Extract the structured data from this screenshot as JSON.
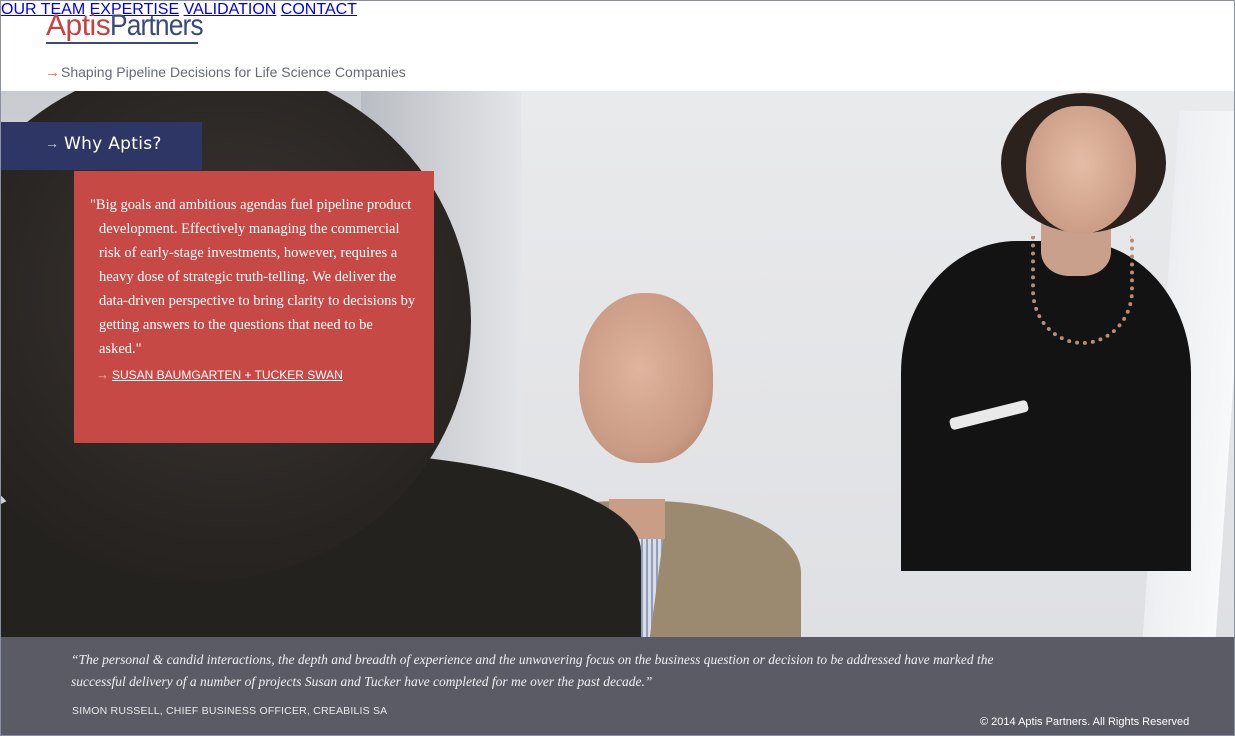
{
  "brand": {
    "logo_part1": "Aptis",
    "logo_part2": "Partners",
    "tagline": "Shaping Pipeline Decisions for Life Science Companies",
    "colors": {
      "red": "#c64946",
      "navy": "#2e3666"
    }
  },
  "nav": {
    "items": [
      {
        "label": "OUR TEAM"
      },
      {
        "label": "EXPERTISE"
      },
      {
        "label": "VALIDATION"
      },
      {
        "label": "CONTACT"
      }
    ]
  },
  "why": {
    "tab_label": "Why Aptis?",
    "arrow_icon": "arrow-right-icon"
  },
  "quote": {
    "text": "\"Big goals and ambitious agendas fuel pipeline product development. Effectively managing the commercial risk of early-stage investments, however, requires a heavy dose of strategic truth-telling. We deliver the data-driven perspective to bring clarity to decisions by getting answers to the questions that need to be asked.\"",
    "author_link": "SUSAN BAUMGARTEN + TUCKER SWAN"
  },
  "footer": {
    "testimonial": "“The personal & candid interactions, the depth and breadth of experience and the unwavering focus on the business question or decision to be addressed have marked the successful delivery of a number of projects Susan and Tucker have completed for me over the past decade.”",
    "attribution": "SIMON RUSSELL, CHIEF BUSINESS OFFICER, CREABILIS SA",
    "copyright": "© 2014 Aptis Partners. All Rights Reserved"
  }
}
